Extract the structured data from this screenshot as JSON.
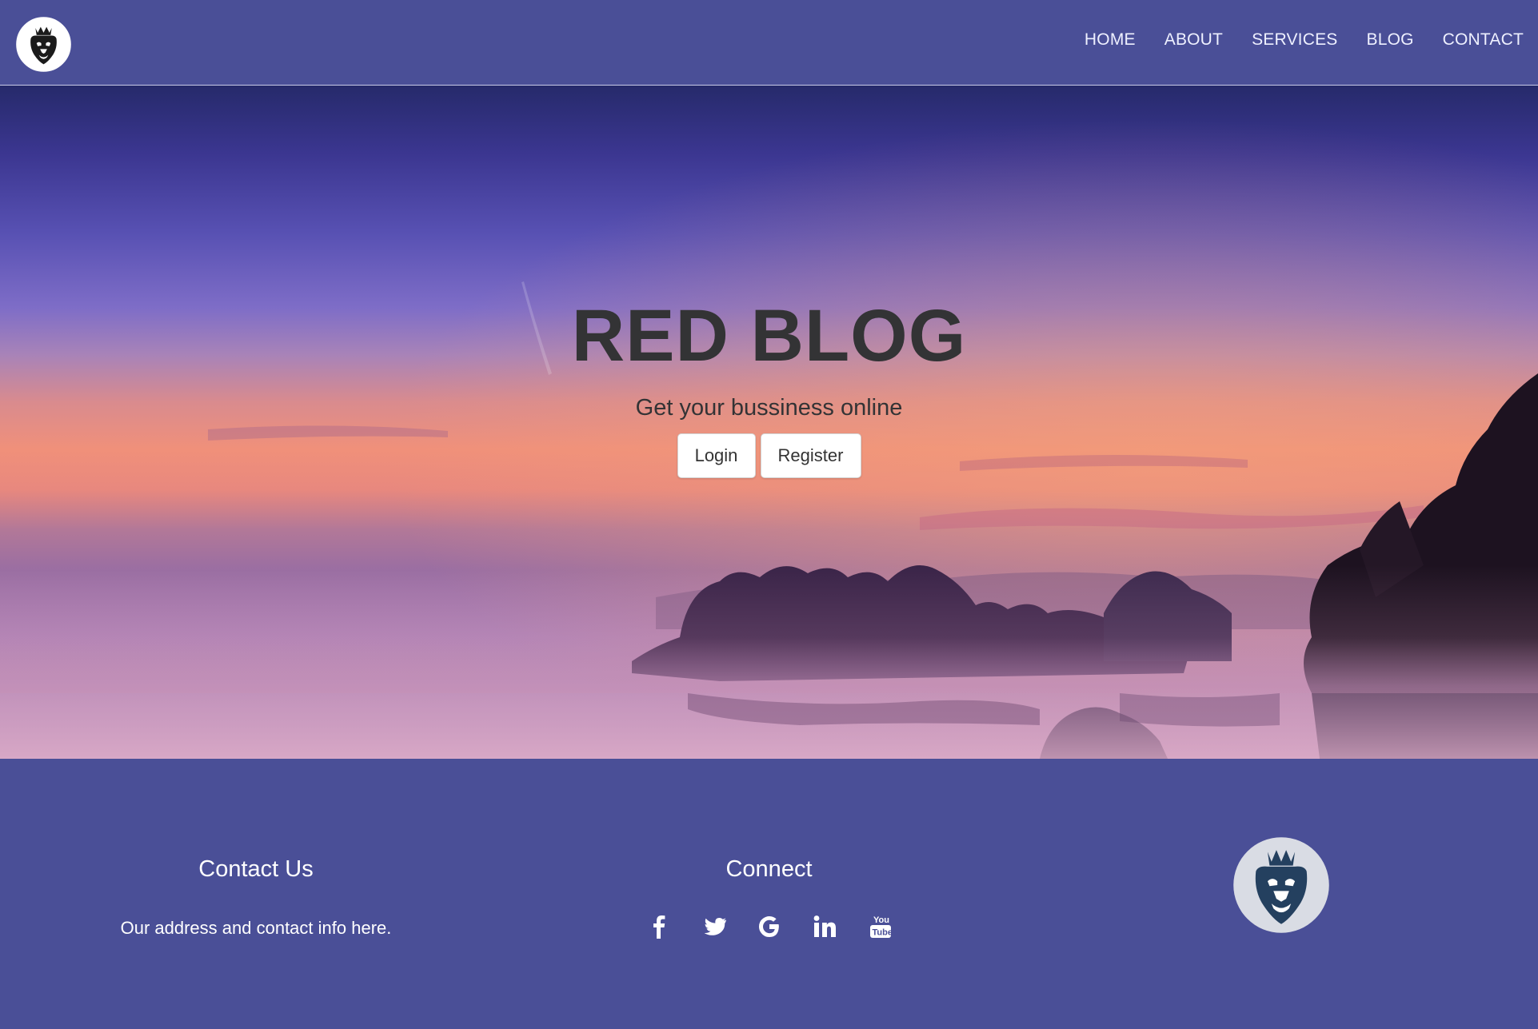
{
  "nav": {
    "logo_icon": "lion-crown-logo-icon",
    "items": [
      {
        "label": "HOME"
      },
      {
        "label": "ABOUT"
      },
      {
        "label": "SERVICES"
      },
      {
        "label": "BLOG"
      },
      {
        "label": "CONTACT"
      }
    ]
  },
  "hero": {
    "title": "RED BLOG",
    "subtitle": "Get your bussiness online",
    "login_label": "Login",
    "register_label": "Register",
    "background": "sunset-lake-landscape"
  },
  "footer": {
    "contact_heading": "Contact Us",
    "contact_text": "Our address and contact info here.",
    "connect_heading": "Connect",
    "social_icons": [
      "facebook-icon",
      "twitter-icon",
      "google-icon",
      "linkedin-icon",
      "youtube-icon"
    ],
    "logo_icon": "lion-crown-logo-icon"
  },
  "colors": {
    "nav_bg": "#4a4f97",
    "footer_bg": "#4a4f97",
    "title_text": "#333335",
    "white": "#ffffff"
  }
}
